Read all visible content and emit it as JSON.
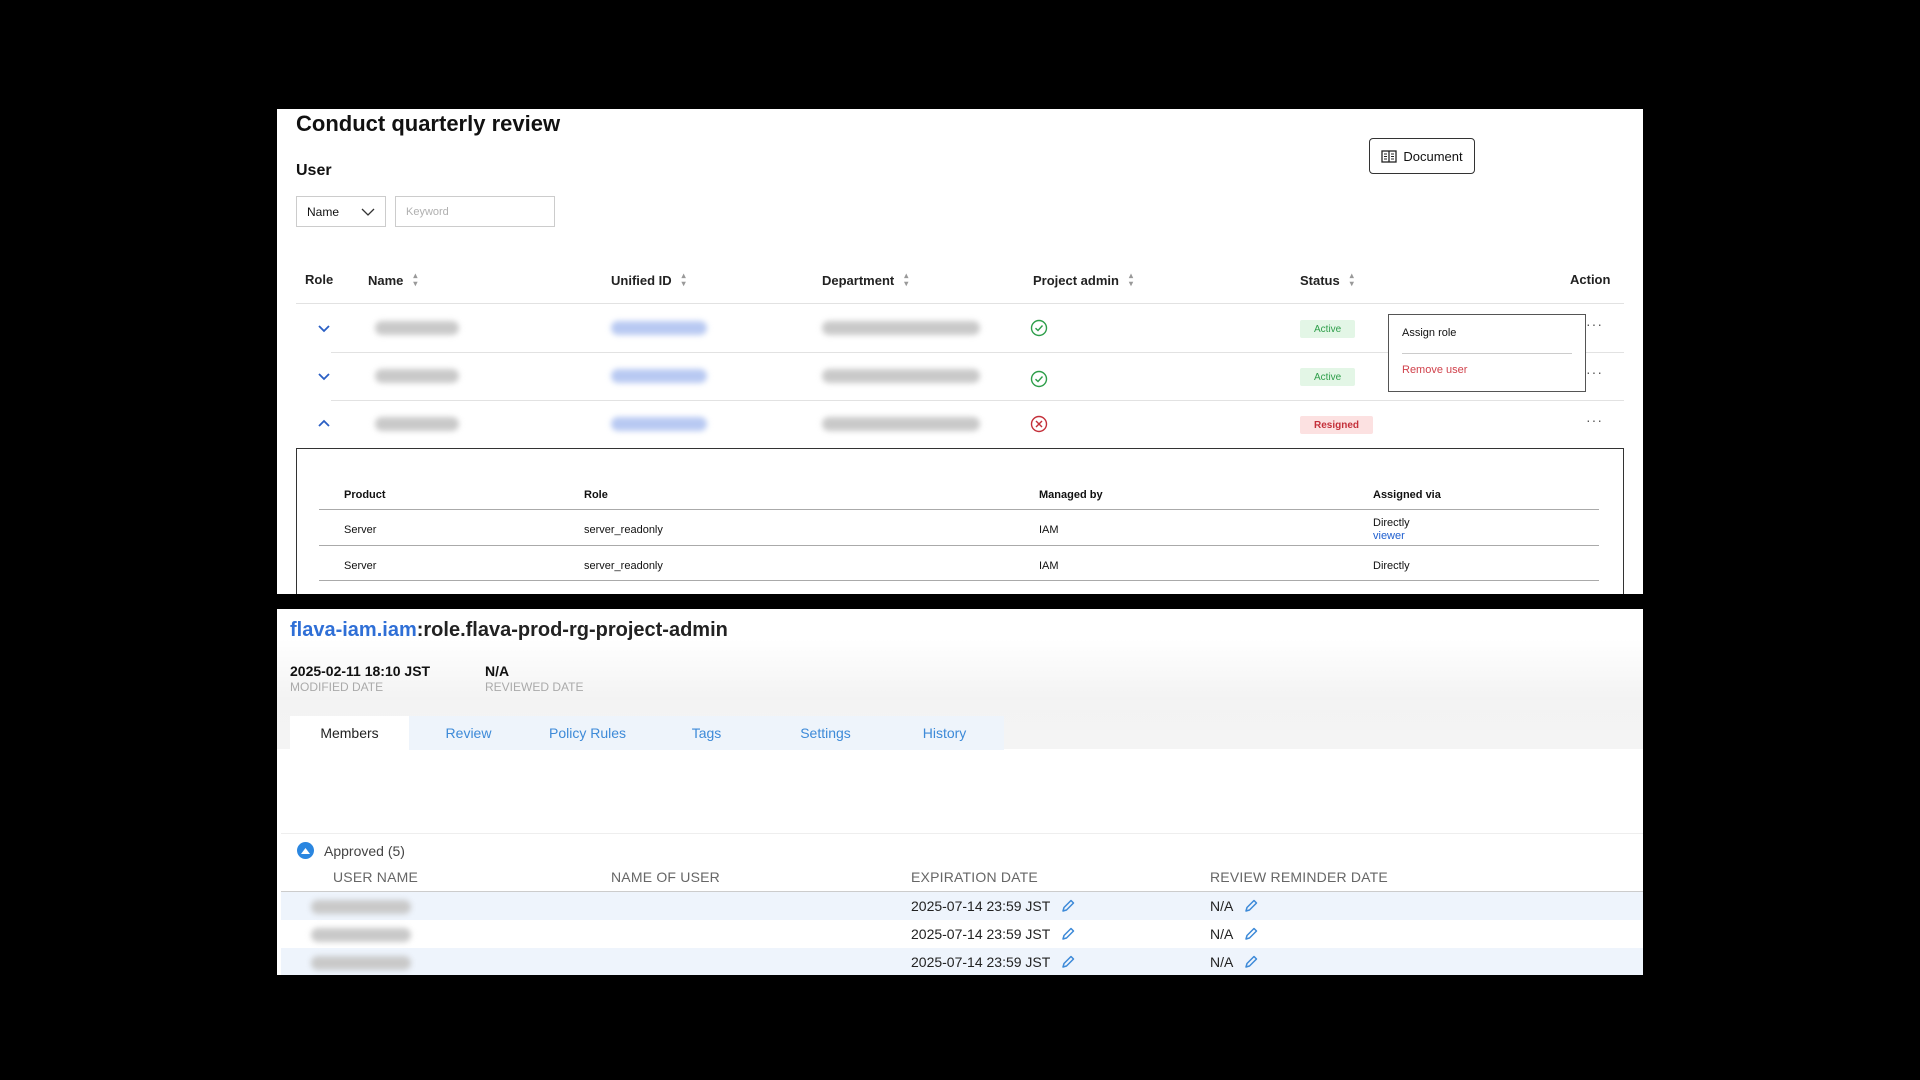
{
  "review": {
    "title": "Conduct quarterly review",
    "section": "User",
    "document_button": "Document",
    "filter": {
      "select_value": "Name",
      "keyword_placeholder": "Keyword"
    },
    "columns": {
      "role": "Role",
      "name": "Name",
      "unified_id": "Unified ID",
      "department": "Department",
      "project_admin": "Project admin",
      "status": "Status",
      "action": "Action"
    },
    "rows": [
      {
        "expanded": false,
        "project_admin": true,
        "status": "Active"
      },
      {
        "expanded": false,
        "project_admin": true,
        "status": "Active"
      },
      {
        "expanded": true,
        "project_admin": false,
        "status": "Resigned"
      }
    ],
    "menu": {
      "assign_role": "Assign role",
      "remove_user": "Remove user"
    },
    "roles": {
      "columns": {
        "product": "Product",
        "role": "Role",
        "managed_by": "Managed by",
        "assigned_via": "Assigned via"
      },
      "rows": [
        {
          "product": "Server",
          "role": "server_readonly",
          "managed_by": "IAM",
          "assigned_via": "Directly",
          "assigned_link": "viewer"
        },
        {
          "product": "Server",
          "role": "server_readonly",
          "managed_by": "IAM",
          "assigned_via": "Directly"
        }
      ]
    }
  },
  "iam": {
    "namespace": "flava-iam.iam",
    "role_name": ":role.flava-prod-rg-project-admin",
    "modified_date": "2025-02-11 18:10 JST",
    "modified_label": "MODIFIED DATE",
    "reviewed_date": "N/A",
    "reviewed_label": "REVIEWED DATE",
    "tabs": [
      "Members",
      "Review",
      "Policy Rules",
      "Tags",
      "Settings",
      "History"
    ],
    "active_tab": "Members",
    "approved_label": "Approved (5)",
    "member_columns": {
      "user_name": "USER NAME",
      "name_of_user": "NAME OF USER",
      "expiration": "EXPIRATION DATE",
      "reminder": "REVIEW REMINDER DATE"
    },
    "members": [
      {
        "expiration": "2025-07-14 23:59 JST",
        "reminder": "N/A"
      },
      {
        "expiration": "2025-07-14 23:59 JST",
        "reminder": "N/A"
      },
      {
        "expiration": "2025-07-14 23:59 JST",
        "reminder": "N/A"
      }
    ]
  },
  "colors": {
    "accent_blue": "#2f6fd6",
    "active_green": "#2e9e4a",
    "resigned_red": "#c4303a"
  }
}
